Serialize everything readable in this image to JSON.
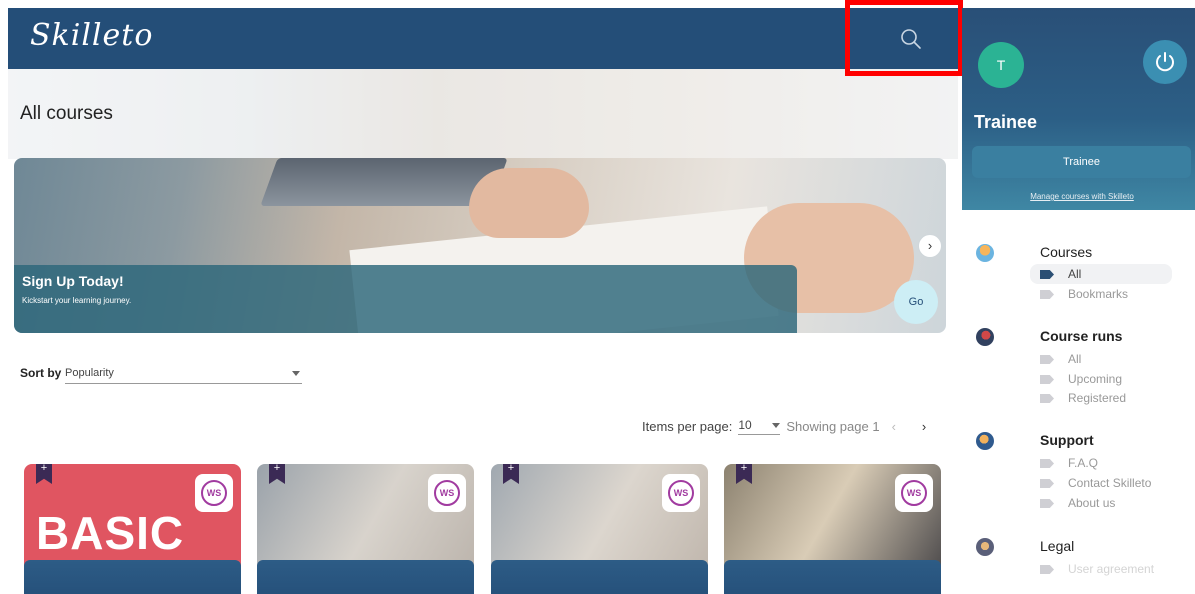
{
  "header": {
    "logo_text": "Skilleto",
    "icons": {
      "search": "search-icon"
    }
  },
  "main": {
    "title": "All courses",
    "banner": {
      "title": "Sign Up Today!",
      "subtitle": "Kickstart your learning journey.",
      "go_label": "Go",
      "next_label": "›"
    },
    "sort": {
      "label": "Sort by",
      "value": "Popularity"
    },
    "pagination": {
      "items_per_page_label": "Items per page:",
      "items_per_page_value": "10",
      "showing_text": "Showing page 1",
      "prev_label": "‹",
      "next_label": "›"
    },
    "cards": [
      {
        "image_text": "BASIC",
        "bookmark_label": "+",
        "badge_text": "WS"
      },
      {
        "bookmark_label": "+",
        "badge_text": "WS"
      },
      {
        "bookmark_label": "+",
        "badge_text": "WS"
      },
      {
        "bookmark_label": "+",
        "badge_text": "WS"
      }
    ]
  },
  "sidebar": {
    "avatar_initial": "T",
    "role_title": "Trainee",
    "role_button": "Trainee",
    "manage_link": "Manage courses with Skilleto",
    "sections": [
      {
        "title": "Courses",
        "items": [
          "All",
          "Bookmarks"
        ]
      },
      {
        "title": "Course runs",
        "items": [
          "All",
          "Upcoming",
          "Registered"
        ]
      },
      {
        "title": "Support",
        "items": [
          "F.A.Q",
          "Contact Skilleto",
          "About us"
        ]
      },
      {
        "title": "Legal",
        "items": [
          "User agreement"
        ]
      }
    ]
  },
  "colors": {
    "brand_dark": "#244e78",
    "accent_teal": "#2bb394",
    "highlight": "#ff0000",
    "ws_purple": "#a13ba0"
  }
}
